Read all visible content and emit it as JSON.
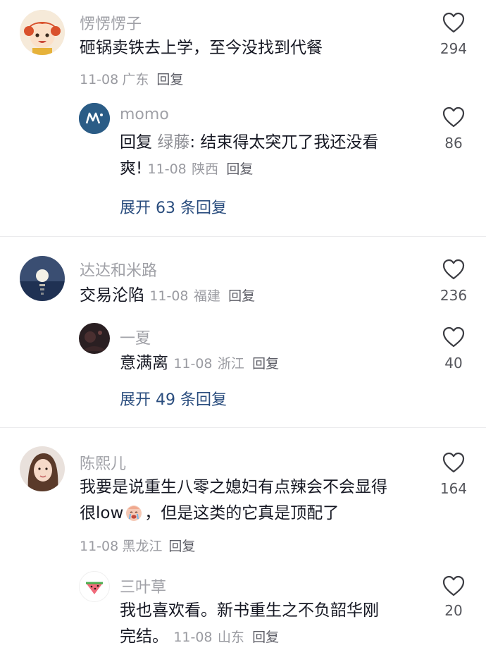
{
  "comments": [
    {
      "username": "愣愣愣子",
      "text": "砸锅卖铁去上学，至今没找到代餐",
      "date": "11-08",
      "location": "广东",
      "reply_label": "回复",
      "likes": "294",
      "reply": {
        "username": "momo",
        "prefix": "回复",
        "mention": "绿藤",
        "text_line1": ": 结束得太突兀了我还没看",
        "text_line2": "爽!",
        "date": "11-08",
        "location": "陕西",
        "reply_label": "回复",
        "likes": "86"
      },
      "expand_label": "展开 63 条回复"
    },
    {
      "username": "达达和米路",
      "text": "交易沦陷",
      "date": "11-08",
      "location": "福建",
      "reply_label": "回复",
      "likes": "236",
      "reply": {
        "username": "一夏",
        "text": "意满离",
        "date": "11-08",
        "location": "浙江",
        "reply_label": "回复",
        "likes": "40"
      },
      "expand_label": "展开 49 条回复"
    },
    {
      "username": "陈熙儿",
      "text_line1": "我要是说重生八零之媳妇有点辣会不会显得",
      "text_line2a": "很low",
      "emoji": "crying-face-emoji",
      "text_line2b": "，但是这类的它真是顶配了",
      "date": "11-08",
      "location": "黑龙江",
      "reply_label": "回复",
      "likes": "164",
      "reply": {
        "username": "三叶草",
        "text_line1": "我也喜欢看。新书重生之不负韶华刚",
        "text_line2": "完结。",
        "date": "11-08",
        "location": "山东",
        "reply_label": "回复",
        "likes": "20"
      }
    }
  ],
  "colors": {
    "username": "#a0a1a7",
    "text": "#161823",
    "meta": "#9a9ba1",
    "expand": "#2a4d7e",
    "mention": "#8a8b91"
  }
}
